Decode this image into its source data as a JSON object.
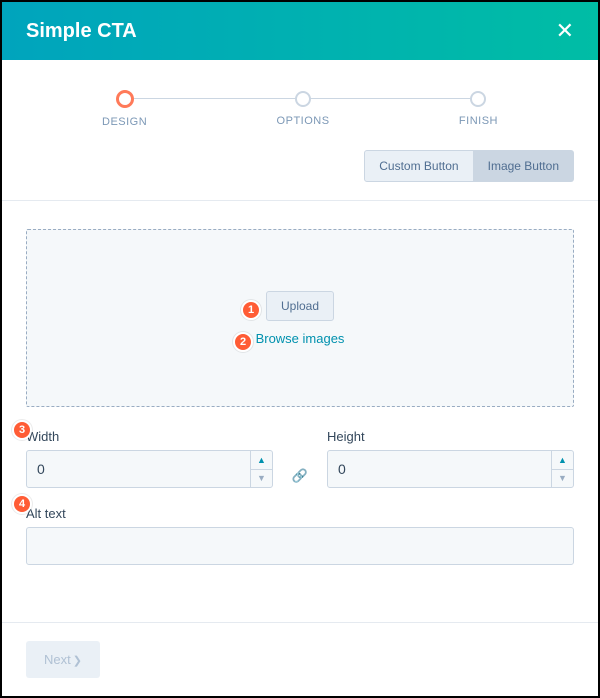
{
  "header": {
    "title": "Simple CTA"
  },
  "stepper": {
    "steps": [
      {
        "label": "DESIGN"
      },
      {
        "label": "OPTIONS"
      },
      {
        "label": "FINISH"
      }
    ]
  },
  "toggle": {
    "custom": "Custom Button",
    "image": "Image Button"
  },
  "dropzone": {
    "upload_label": "Upload",
    "browse_label": "Browse images"
  },
  "fields": {
    "width": {
      "label": "Width",
      "value": "0"
    },
    "height": {
      "label": "Height",
      "value": "0"
    },
    "alt": {
      "label": "Alt text",
      "value": ""
    }
  },
  "footer": {
    "next_label": "Next"
  },
  "annotations": [
    "1",
    "2",
    "3",
    "4"
  ]
}
